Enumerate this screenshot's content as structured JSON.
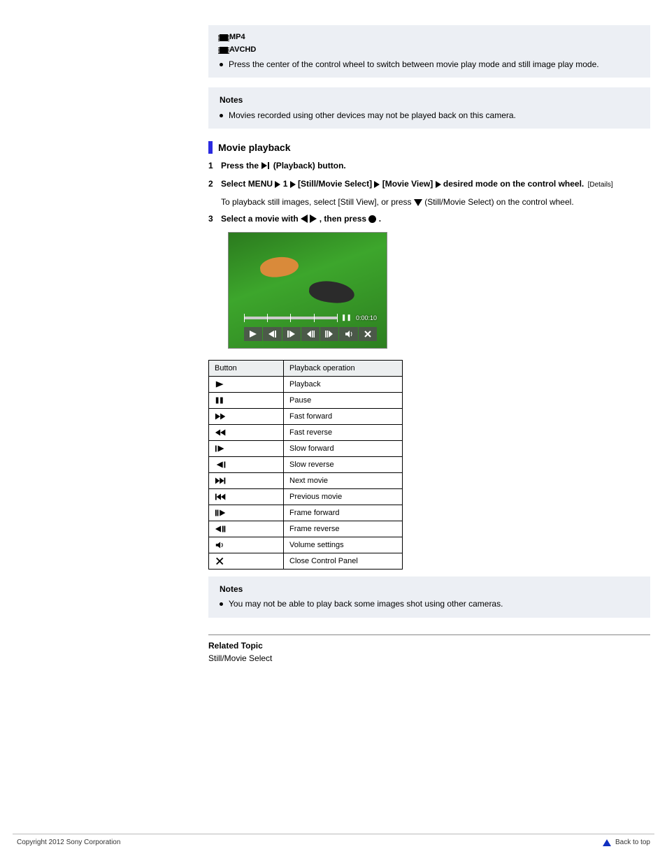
{
  "formats": {
    "mp4": "MP4",
    "avchd": "AVCHD"
  },
  "note1": {
    "bullet": "Press the center of the control wheel to switch between movie play mode and still image play mode."
  },
  "note2_head": "Notes",
  "note2_bullet": "Movies recorded using other devices may not be played back on this camera.",
  "section_title": "Movie playback",
  "step1": {
    "num": "1",
    "text_a": "Press the ",
    "text_b": " (Playback) button."
  },
  "step2": {
    "num": "2",
    "text_a": "Select ",
    "text_b": " with the control wheel. [Details]",
    "link_page": "[Details]"
  },
  "step3": {
    "num": "3",
    "text_a": "Select a movie with ",
    "text_b": " , then press ",
    "text_c": " ."
  },
  "thumb": {
    "time": "0:00:10"
  },
  "table": {
    "head": [
      "Button",
      "Playback operation"
    ],
    "rows": [
      {
        "icon": "play",
        "label": "Playback"
      },
      {
        "icon": "pause",
        "label": "Pause"
      },
      {
        "icon": "ffwd",
        "label": "Fast forward"
      },
      {
        "icon": "frev",
        "label": "Fast reverse"
      },
      {
        "icon": "slowf",
        "label": "Slow forward"
      },
      {
        "icon": "slowr",
        "label": "Slow reverse"
      },
      {
        "icon": "next",
        "label": "Next movie"
      },
      {
        "icon": "prev",
        "label": "Previous movie"
      },
      {
        "icon": "framef",
        "label": "Frame forward"
      },
      {
        "icon": "framer",
        "label": "Frame reverse"
      },
      {
        "icon": "vol",
        "label": "Volume settings"
      },
      {
        "icon": "close",
        "label": "Close Control Panel"
      }
    ]
  },
  "note3_head": "Notes",
  "note3_bullet": "You may not be able to play back some images shot using other cameras.",
  "related": "Related Topic",
  "related_item": "Still/Movie Select",
  "copyright": "Copyright 2012 Sony Corporation",
  "backtop": "Back to top"
}
